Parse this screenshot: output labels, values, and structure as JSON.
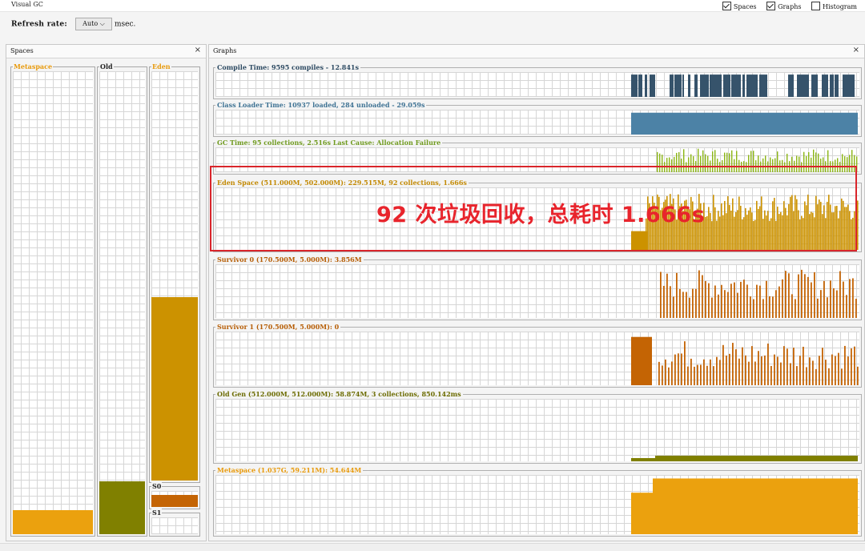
{
  "window": {
    "title": "Visual GC"
  },
  "view_options": [
    {
      "label": "Spaces",
      "checked": true
    },
    {
      "label": "Graphs",
      "checked": true
    },
    {
      "label": "Histogram",
      "checked": false
    }
  ],
  "refresh": {
    "label": "Refresh rate:",
    "value": "Auto",
    "unit": "msec."
  },
  "spaces_panel": {
    "title": "Spaces",
    "close": "×",
    "columns": [
      {
        "label": "Metaspace",
        "label_color": "#e89a0c",
        "fill_color": "#eba10e",
        "fill_fraction": 0.052
      },
      {
        "label": "Old",
        "label_color": "#222222",
        "fill_color": "#808000",
        "fill_fraction": 0.114
      },
      {
        "label": "Eden",
        "label_color": "#e89a0c",
        "fill_color": "#cc9200",
        "fill_fraction": 0.449
      },
      {
        "label": "S0",
        "label_color": "#222222",
        "fill_color": "#c46404",
        "fill_fraction": 0.77
      },
      {
        "label": "S1",
        "label_color": "#222222",
        "fill_color": "#c46404",
        "fill_fraction": 0.0
      }
    ]
  },
  "graphs_panel": {
    "title": "Graphs",
    "close": "×",
    "graphs": [
      {
        "label": "Compile Time: 9595 compiles - 12.841s",
        "label_color": "#2d4a62",
        "color": "#36536b",
        "kind": "compile"
      },
      {
        "label": "Class Loader Time: 10937 loaded, 284 unloaded - 29.059s",
        "label_color": "#3f7394",
        "color": "#4c82a6",
        "kind": "classloader"
      },
      {
        "label": "GC Time: 95 collections, 2.516s  Last Cause: Allocation Failure",
        "label_color": "#6f9a1e",
        "color": "#8bb514",
        "kind": "gc"
      },
      {
        "label": "Eden Space (511.000M, 502.000M): 229.515M, 92 collections, 1.666s",
        "label_color": "#c28800",
        "color": "#cc9200",
        "kind": "eden"
      },
      {
        "label": "Survivor 0 (170.500M, 5.000M): 3.856M",
        "label_color": "#b65d05",
        "color": "#c46404",
        "kind": "s0"
      },
      {
        "label": "Survivor 1 (170.500M, 5.000M): 0",
        "label_color": "#b65d05",
        "color": "#c46404",
        "kind": "s1"
      },
      {
        "label": "Old Gen (512.000M, 512.000M): 58.874M, 3 collections, 850.142ms",
        "label_color": "#6b6b00",
        "color": "#808000",
        "kind": "old"
      },
      {
        "label": "Metaspace (1.037G, 59.211M): 54.644M",
        "label_color": "#e89a0c",
        "color": "#eba10e",
        "kind": "meta"
      }
    ]
  },
  "annotation": {
    "text": "92 次垃圾回收，总耗时 1.666s",
    "color": "#e8242c"
  }
}
